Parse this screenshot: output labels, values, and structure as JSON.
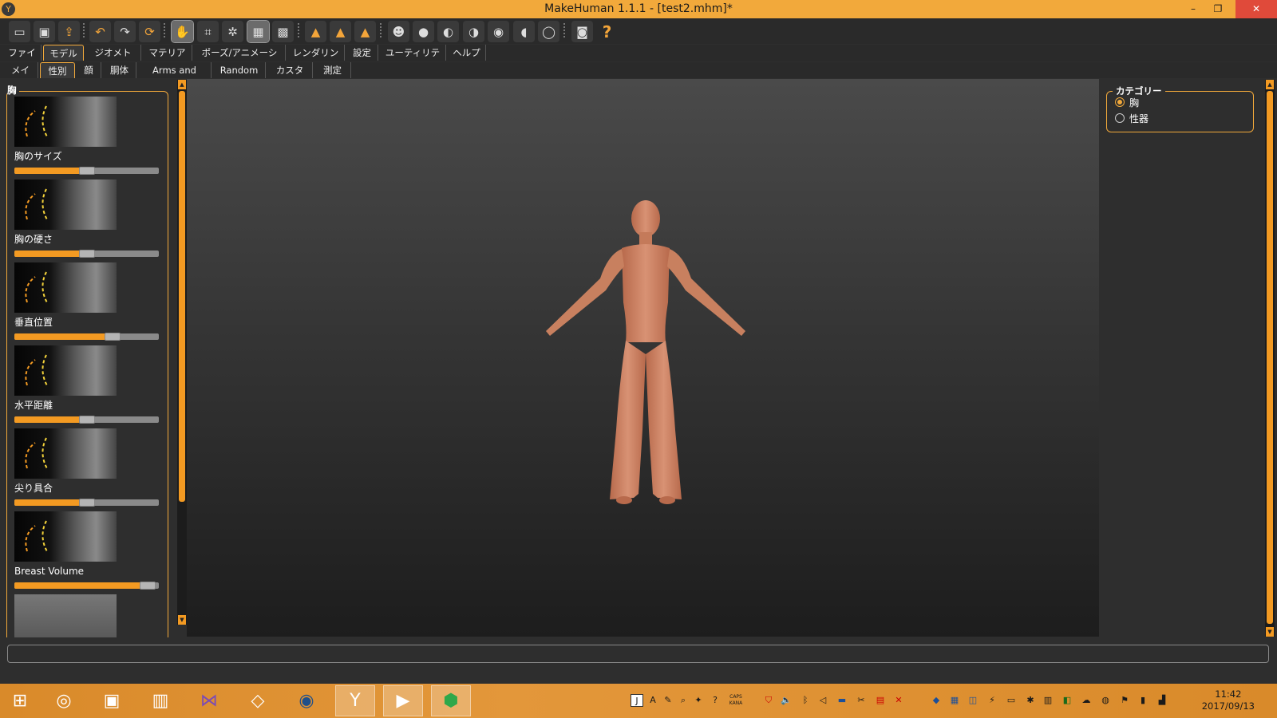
{
  "window": {
    "title": "MakeHuman 1.1.1 - [test2.mhm]*",
    "app_icon": "makehuman-logo-icon",
    "controls": {
      "minimize": "–",
      "restore": "❐",
      "close": "✕"
    }
  },
  "toolbar": {
    "icons": [
      "open-icon",
      "save-icon",
      "export-icon",
      "undo-icon",
      "redo-icon",
      "reset-icon",
      "smooth-icon",
      "wireframe-icon",
      "pose-icon",
      "grid-icon",
      "background-icon",
      "front-view-icon",
      "side-view-icon",
      "back-view-icon",
      "face-icon",
      "head-icon",
      "left-view-icon",
      "right-view-icon",
      "top-view-icon",
      "bottom-view-icon",
      "reset-camera-icon",
      "screenshot-icon",
      "help-icon"
    ],
    "help_glyph": "?"
  },
  "main_tabs": [
    {
      "label": "ファイル",
      "active": false
    },
    {
      "label": "モデル",
      "active": true
    },
    {
      "label": "ジオメトリー",
      "active": false
    },
    {
      "label": "マテリアル",
      "active": false
    },
    {
      "label": "ポーズ/アニメーション",
      "active": false
    },
    {
      "label": "レンダリング",
      "active": false
    },
    {
      "label": "設定",
      "active": false
    },
    {
      "label": "ユーティリティ",
      "active": false
    },
    {
      "label": "ヘルプ",
      "active": false
    }
  ],
  "sub_tabs": [
    {
      "label": "メイン",
      "active": false
    },
    {
      "label": "性別",
      "active": true
    },
    {
      "label": "顔",
      "active": false
    },
    {
      "label": "胴体",
      "active": false
    },
    {
      "label": "Arms and legs",
      "active": false
    },
    {
      "label": "Random",
      "active": false
    },
    {
      "label": "カスタム",
      "active": false
    },
    {
      "label": "測定",
      "active": false
    }
  ],
  "left_panel": {
    "group_title": "胸",
    "sliders": [
      {
        "label": "胸のサイズ",
        "value": 0.5
      },
      {
        "label": "胸の硬さ",
        "value": 0.5
      },
      {
        "label": "垂直位置",
        "value": 0.68
      },
      {
        "label": "水平距離",
        "value": 0.5
      },
      {
        "label": "尖り具合",
        "value": 0.5
      },
      {
        "label": "Breast Volume",
        "value": 0.92
      }
    ]
  },
  "right_panel": {
    "category_title": "カテゴリー",
    "options": [
      {
        "label": "胸",
        "selected": true
      },
      {
        "label": "性器",
        "selected": false
      }
    ]
  },
  "status_bar": {
    "text": ""
  },
  "taskbar": {
    "apps": [
      "windows-start-icon",
      "speaker-app-icon",
      "game-app-icon",
      "hwp-app-icon",
      "visual-studio-icon",
      "unity-icon",
      "blender-icon",
      "makehuman-icon",
      "media-player-icon",
      "green-app-icon"
    ],
    "clock": {
      "time": "11:42",
      "date": "2017/09/13"
    },
    "tray_text": {
      "ime": "A",
      "caps": "CAPS",
      "kana": "KANA"
    }
  },
  "colors": {
    "accent": "#f2a93b",
    "slider_fill": "#f39a22",
    "taskbar": "#e3973a"
  }
}
